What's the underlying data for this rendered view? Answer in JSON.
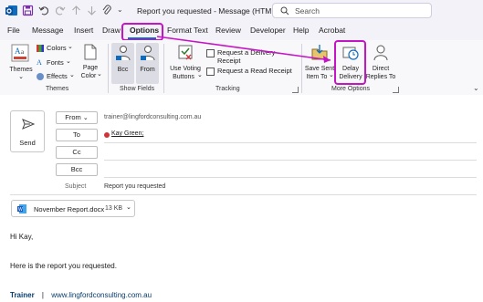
{
  "window": {
    "title": "Report you requested  -  Message (HTML)",
    "search_placeholder": "Search"
  },
  "tabs": [
    "File",
    "Message",
    "Insert",
    "Draw",
    "Options",
    "Format Text",
    "Review",
    "Developer",
    "Help",
    "Acrobat"
  ],
  "active_tab": "Options",
  "ribbon": {
    "themes": {
      "themes_label": "Themes",
      "colors_label": "Colors",
      "fonts_label": "Fonts",
      "effects_label": "Effects",
      "page_color_line1": "Page",
      "page_color_line2": "Color",
      "group_label": "Themes"
    },
    "show_fields": {
      "bcc_label": "Bcc",
      "from_label": "From",
      "group_label": "Show Fields"
    },
    "tracking": {
      "use_voting_line1": "Use Voting",
      "use_voting_line2": "Buttons",
      "delivery_receipt": "Request a Delivery Receipt",
      "read_receipt": "Request a Read Receipt",
      "group_label": "Tracking"
    },
    "more_options": {
      "save_sent_line1": "Save Sent",
      "save_sent_line2": "Item To",
      "delay_line1": "Delay",
      "delay_line2": "Delivery",
      "direct_line1": "Direct",
      "direct_line2": "Replies To",
      "group_label": "More Options"
    }
  },
  "compose": {
    "send_label": "Send",
    "from_label": "From",
    "from_value": "trainer@lingfordconsulting.com.au",
    "to_label": "To",
    "to_recipient": "Kay Green;",
    "cc_label": "Cc",
    "bcc_label": "Bcc",
    "subject_label": "Subject",
    "subject_value": "Report you requested",
    "attachment_name": "November Report.docx",
    "attachment_size": "13 KB"
  },
  "body": {
    "greeting": "Hi Kay,",
    "line1": "Here is the report you requested.",
    "sig_name": "Trainer",
    "sig_sep": "|",
    "sig_url": "www.lingfordconsulting.com.au"
  },
  "colors": {
    "highlight": "#c514c5",
    "outlook_blue": "#0f6cbd",
    "presence_red": "#d13438"
  }
}
